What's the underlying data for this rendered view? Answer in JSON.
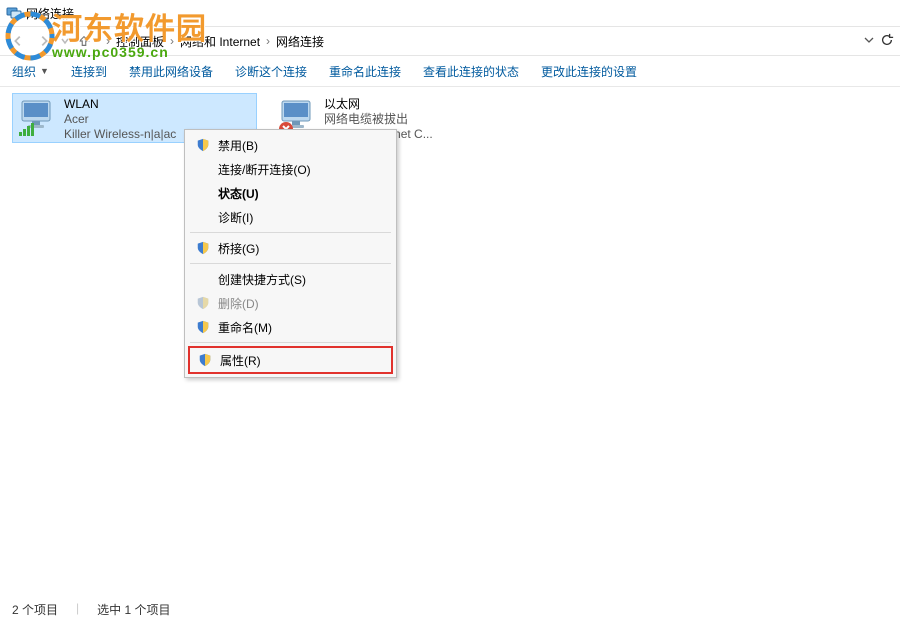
{
  "window_title": "网络连接",
  "breadcrumb": {
    "seg1": "控制面板",
    "seg2": "网络和 Internet",
    "seg3": "网络连接"
  },
  "toolbar": {
    "organize": "组织",
    "connect": "连接到",
    "disable": "禁用此网络设备",
    "diagnose": "诊断这个连接",
    "rename": "重命名此连接",
    "viewstatus": "查看此连接的状态",
    "changeset": "更改此连接的设置"
  },
  "adapters": {
    "wlan": {
      "name": "WLAN",
      "line2": "Acer",
      "line3": "Killer Wireless-n|a|ac"
    },
    "eth": {
      "name": "以太网",
      "line2": "网络电缆被拔出",
      "line3": "Gigabit Ethernet C..."
    }
  },
  "contextmenu": {
    "disable": "禁用(B)",
    "connect": "连接/断开连接(O)",
    "status": "状态(U)",
    "diagnose": "诊断(I)",
    "bridge": "桥接(G)",
    "shortcut": "创建快捷方式(S)",
    "delete": "删除(D)",
    "rename": "重命名(M)",
    "properties": "属性(R)"
  },
  "statusbar": {
    "items": "2 个项目",
    "selected": "选中 1 个项目"
  },
  "watermark": {
    "text": "河东软件园",
    "url": "www.pc0359.cn"
  }
}
